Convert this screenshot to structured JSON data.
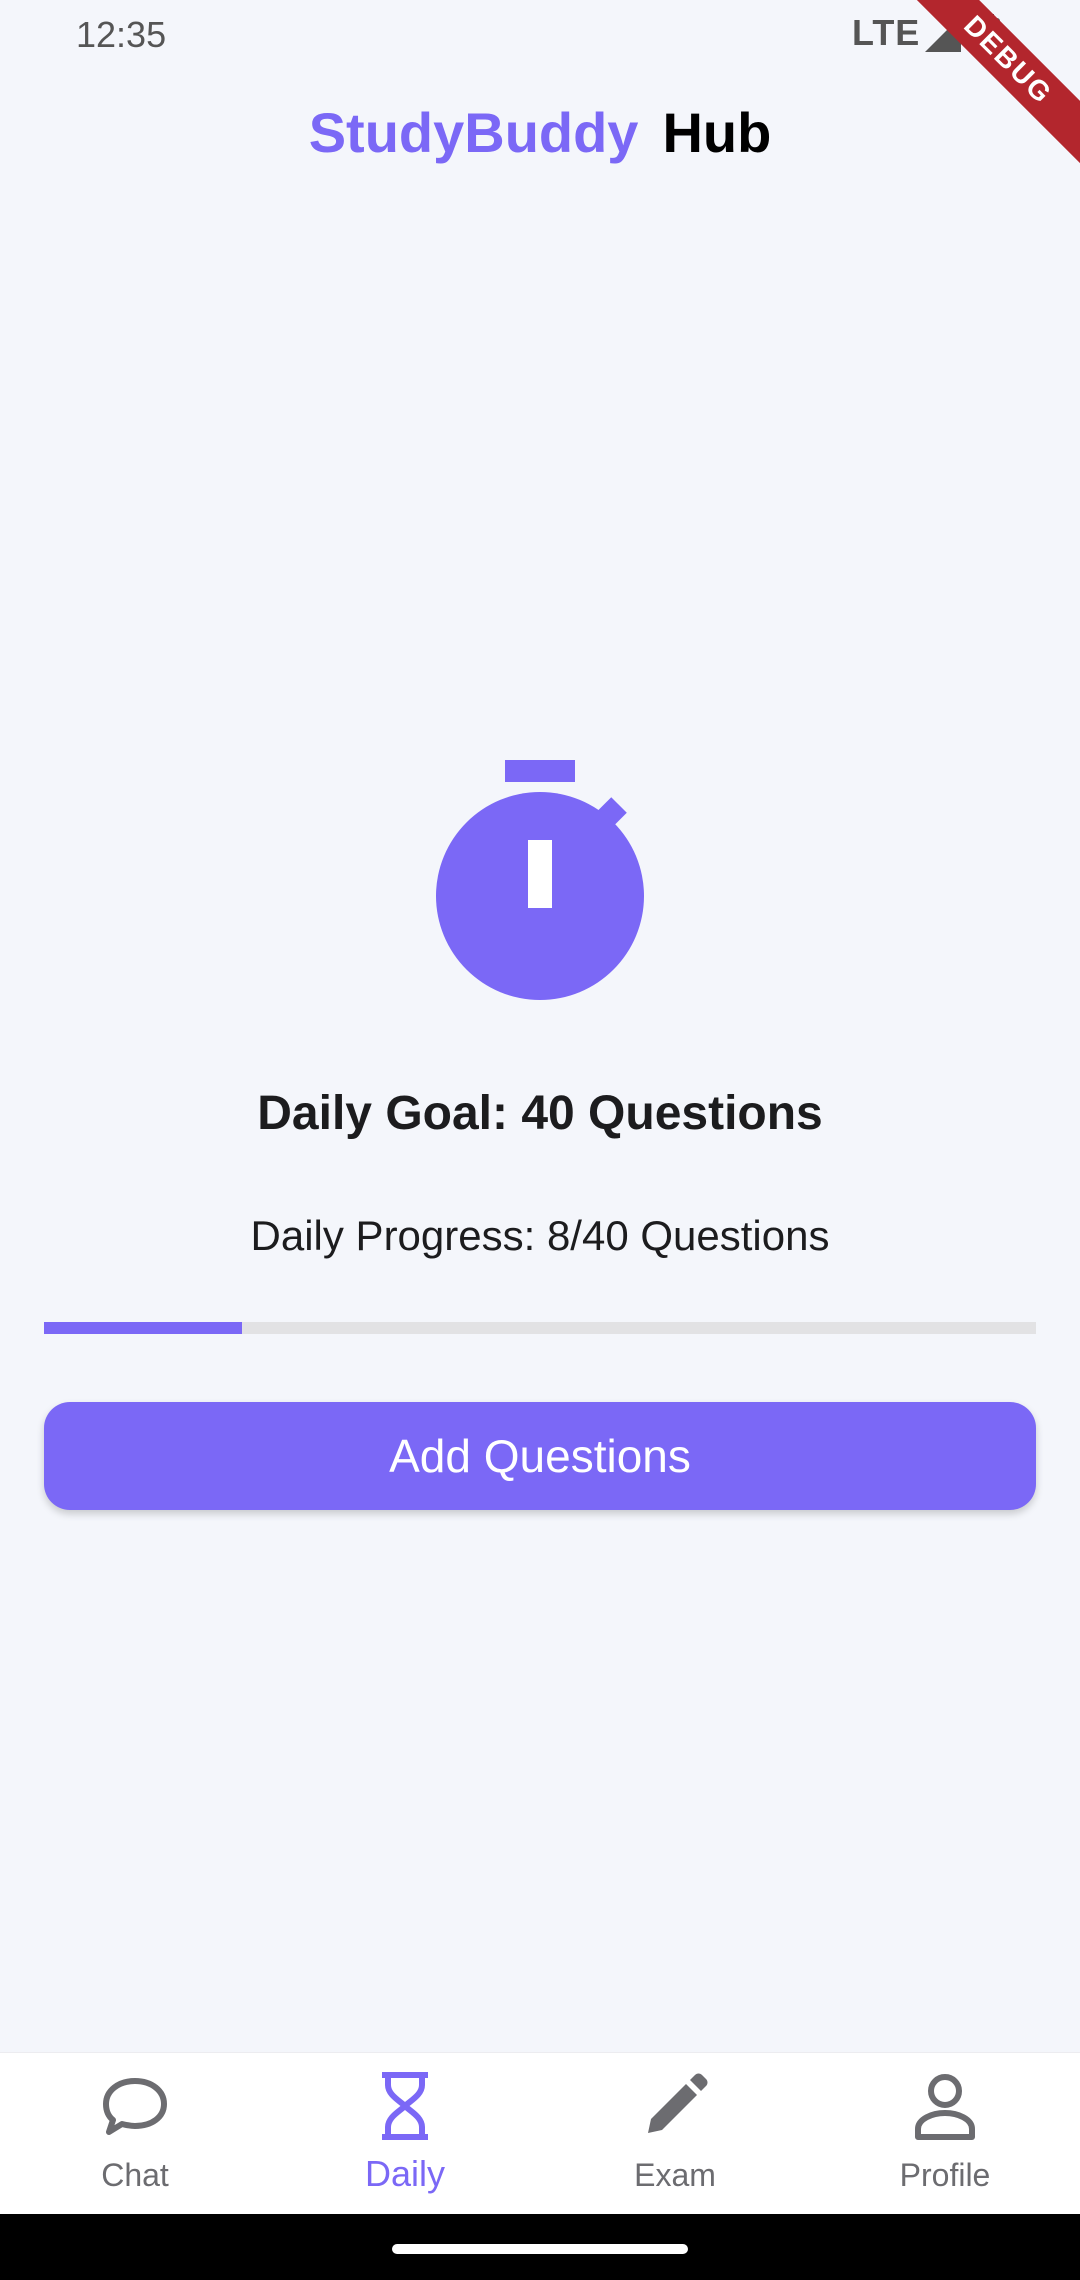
{
  "status_bar": {
    "time": "12:35",
    "network": "LTE"
  },
  "debug_banner": "DEBUG",
  "app_bar": {
    "title_brand": "StudyBuddy",
    "title_suffix": "Hub"
  },
  "main": {
    "goal_text": "Daily Goal: 40 Questions",
    "progress_text": "Daily Progress: 8/40 Questions",
    "progress_fraction": 0.2,
    "add_button_label": "Add Questions",
    "icon": "stopwatch-icon"
  },
  "bottom_nav": {
    "items": [
      {
        "label": "Chat",
        "icon": "chat-bubble-icon",
        "active": false
      },
      {
        "label": "Daily",
        "icon": "hourglass-icon",
        "active": true
      },
      {
        "label": "Exam",
        "icon": "pencil-icon",
        "active": false
      },
      {
        "label": "Profile",
        "icon": "person-icon",
        "active": false
      }
    ]
  },
  "colors": {
    "accent": "#7b68f6",
    "background": "#f4f6fb",
    "debug": "#b3262d"
  }
}
